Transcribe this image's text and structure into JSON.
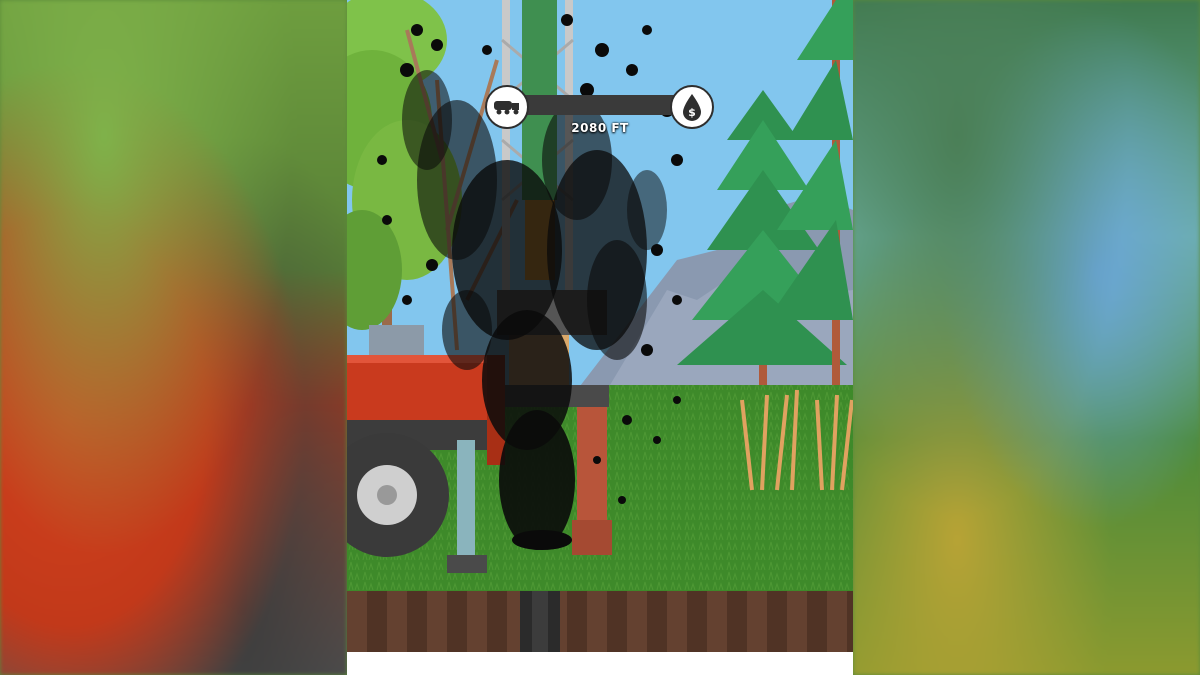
{
  "hud": {
    "depth_text": "2080 FT",
    "left_icon": "tanker-truck-icon",
    "right_icon": "oil-drop-dollar-icon",
    "bar_color": "#3a3a3a"
  },
  "scene": {
    "sky_color": "#82c6ee",
    "grass_color": "#3e8a2a",
    "soil_color": "#5a3a2a",
    "tractor_color": "#c93a1e",
    "oil_color": "#0a0a0a"
  }
}
